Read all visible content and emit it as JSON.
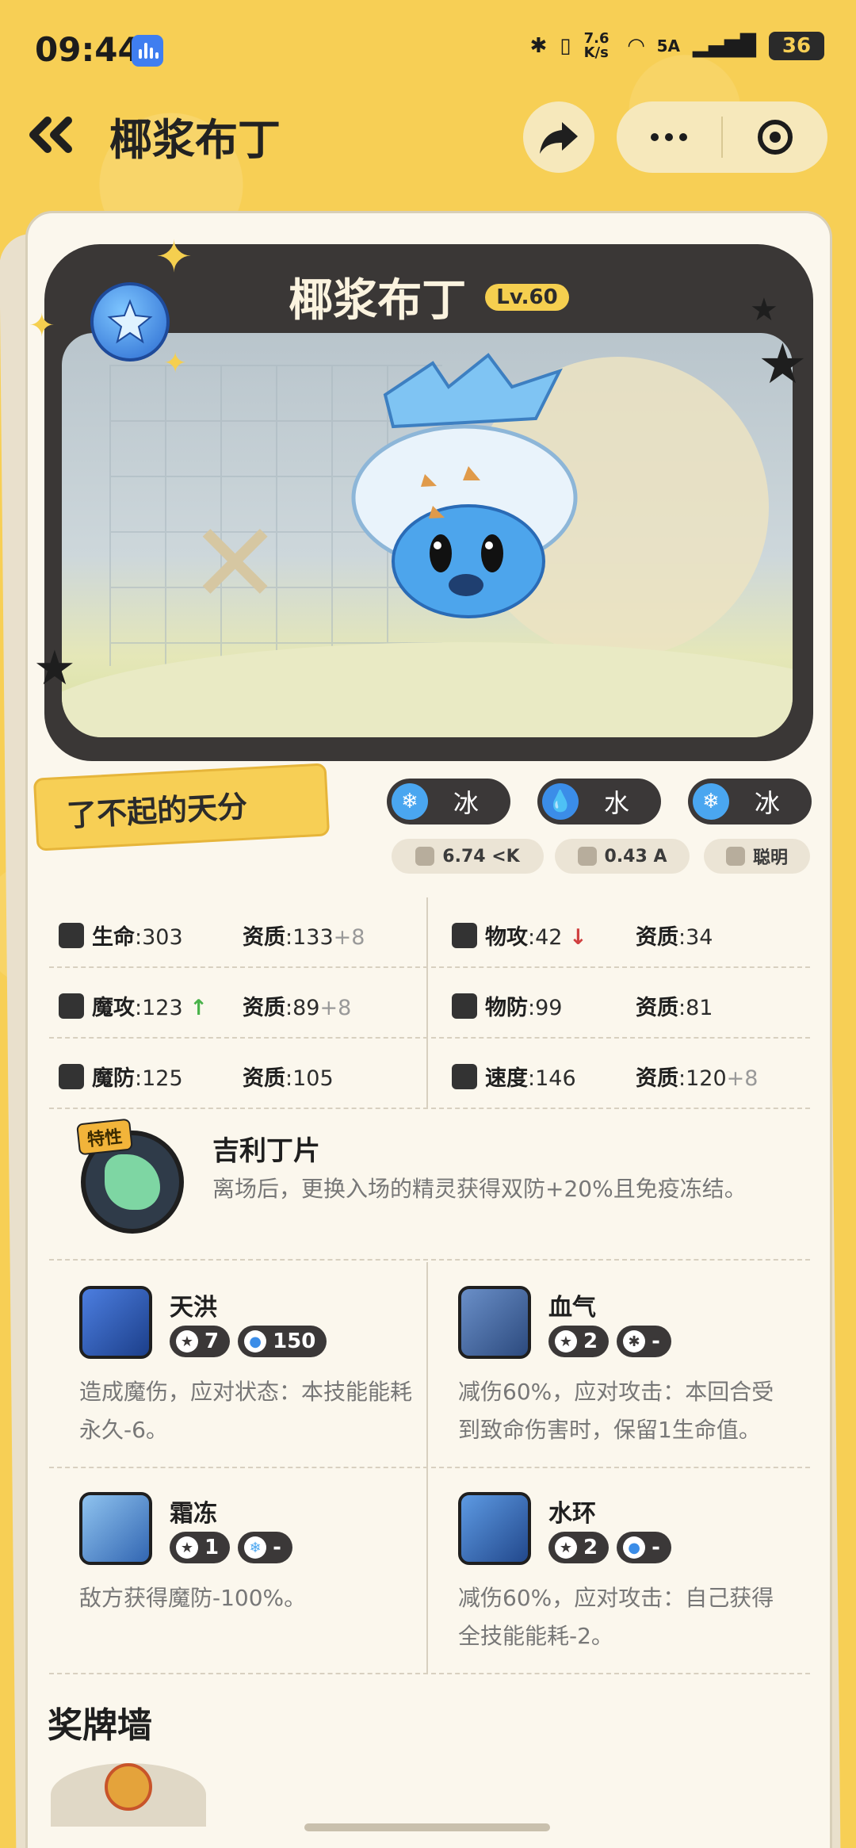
{
  "status": {
    "time": "09:44",
    "network_speed": "7.6 K/s",
    "signal": "5A",
    "battery": "36"
  },
  "header": {
    "title": "椰浆布丁"
  },
  "hero": {
    "name": "椰浆布丁",
    "level": "Lv.60"
  },
  "talent": "了不起的天分",
  "types": [
    {
      "icon": "snowflake-icon",
      "label": "冰"
    },
    {
      "icon": "water-drop-icon",
      "label": "水"
    },
    {
      "icon": "snowflake-icon",
      "label": "冰"
    }
  ],
  "meta": {
    "weight": "6.74 <K",
    "height": "0.43 A",
    "personality": "聪明"
  },
  "stats": [
    {
      "left": {
        "name": "生命",
        "value": ":303",
        "quality_label": "资质",
        "quality": ":133",
        "bonus": "+8"
      },
      "right": {
        "name": "物攻",
        "value": ":42",
        "arrow": "down",
        "quality_label": "资质",
        "quality": ":34",
        "bonus": ""
      }
    },
    {
      "left": {
        "name": "魔攻",
        "value": ":123",
        "arrow": "up",
        "quality_label": "资质",
        "quality": ":89",
        "bonus": "+8"
      },
      "right": {
        "name": "物防",
        "value": ":99",
        "quality_label": "资质",
        "quality": ":81",
        "bonus": ""
      }
    },
    {
      "left": {
        "name": "魔防",
        "value": ":125",
        "quality_label": "资质",
        "quality": ":105",
        "bonus": ""
      },
      "right": {
        "name": "速度",
        "value": ":146",
        "quality_label": "资质",
        "quality": ":120",
        "bonus": "+8"
      }
    }
  ],
  "trait": {
    "tag": "特性",
    "name": "吉利丁片",
    "desc": "离场后，更换入场的精灵获得双防+20%且免疫冻结。"
  },
  "skills": [
    {
      "name": "天洪",
      "star": "7",
      "cost_icon": "water-drop-icon",
      "cost": "150",
      "desc": "造成魔伤，应对状态：本技能能耗永久-6。"
    },
    {
      "name": "血气",
      "star": "2",
      "cost_icon": "normal-icon",
      "cost": "-",
      "desc": "减伤60%，应对攻击：本回合受到致命伤害时，保留1生命值。"
    },
    {
      "name": "霜冻",
      "star": "1",
      "cost_icon": "snowflake-icon",
      "cost": "-",
      "desc": "敌方获得魔防-100%。"
    },
    {
      "name": "水环",
      "star": "2",
      "cost_icon": "water-drop-icon",
      "cost": "-",
      "desc": "减伤60%，应对攻击：自己获得全技能能耗-2。"
    }
  ],
  "medal_wall": "奖牌墙",
  "colors": {
    "background": "#f7cf55",
    "card": "#fbf7ed",
    "dark_pill": "#3b3838",
    "ice": "#4aa6f0",
    "water": "#3b8de8"
  }
}
